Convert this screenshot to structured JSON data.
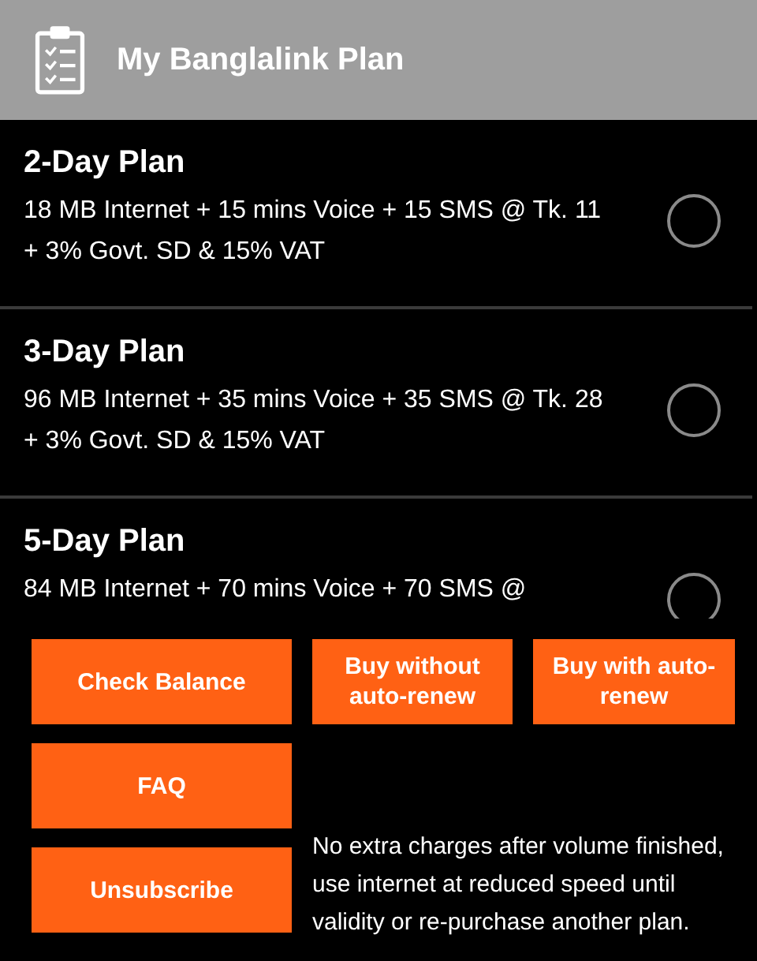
{
  "app_bar": {
    "title": "My Banglalink Plan"
  },
  "plans": [
    {
      "name": "2-Day Plan",
      "description": "18 MB Internet + 15 mins Voice + 15 SMS @ Tk. 11 + 3% Govt. SD & 15% VAT",
      "selected": false
    },
    {
      "name": "3-Day Plan",
      "description": "96 MB Internet + 35 mins Voice + 35 SMS @ Tk. 28 + 3% Govt. SD & 15% VAT",
      "selected": false
    },
    {
      "name": "5-Day Plan",
      "description": "84 MB Internet + 70 mins Voice + 70 SMS @",
      "selected": false
    }
  ],
  "buttons": [
    "Check Balance",
    "Buy without auto-renew",
    "Buy with auto-renew",
    "FAQ",
    "Unsubscribe"
  ],
  "note": "No extra charges after volume finished, use internet at reduced speed until validity or re-purchase another plan."
}
